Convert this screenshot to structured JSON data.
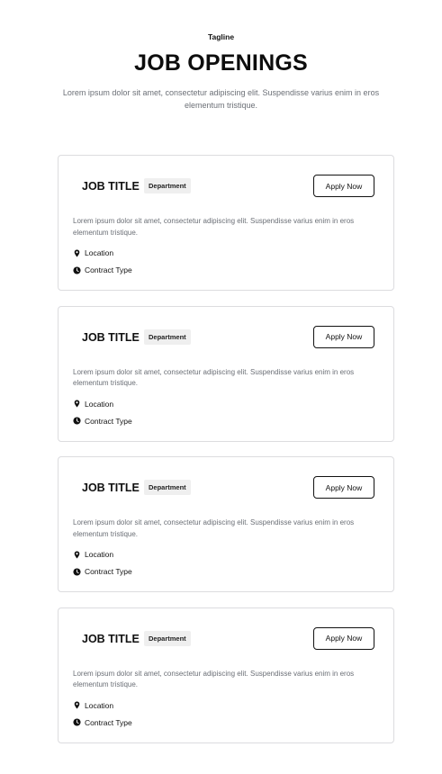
{
  "header": {
    "tagline": "Tagline",
    "title": "JOB OPENINGS",
    "description": "Lorem ipsum dolor sit amet, consectetur adipiscing elit. Suspendisse varius enim in eros elementum tristique."
  },
  "jobs": [
    {
      "title": "JOB TITLE",
      "department": "Department",
      "apply_label": "Apply Now",
      "description": "Lorem ipsum dolor sit amet, consectetur adipiscing elit. Suspendisse varius enim in eros elementum tristique.",
      "location": "Location",
      "contract_type": "Contract Type"
    },
    {
      "title": "JOB TITLE",
      "department": "Department",
      "apply_label": "Apply Now",
      "description": "Lorem ipsum dolor sit amet, consectetur adipiscing elit. Suspendisse varius enim in eros elementum tristique.",
      "location": "Location",
      "contract_type": "Contract Type"
    },
    {
      "title": "JOB TITLE",
      "department": "Department",
      "apply_label": "Apply Now",
      "description": "Lorem ipsum dolor sit amet, consectetur adipiscing elit. Suspendisse varius enim in eros elementum tristique.",
      "location": "Location",
      "contract_type": "Contract Type"
    },
    {
      "title": "JOB TITLE",
      "department": "Department",
      "apply_label": "Apply Now",
      "description": "Lorem ipsum dolor sit amet, consectetur adipiscing elit. Suspendisse varius enim in eros elementum tristique.",
      "location": "Location",
      "contract_type": "Contract Type"
    }
  ],
  "icons": {
    "location": "map-pin-icon",
    "contract": "clock-icon"
  },
  "colors": {
    "text": "#111111",
    "muted_text": "#6b6f76",
    "card_border": "#dcdcdf",
    "badge_bg": "#efefef"
  }
}
